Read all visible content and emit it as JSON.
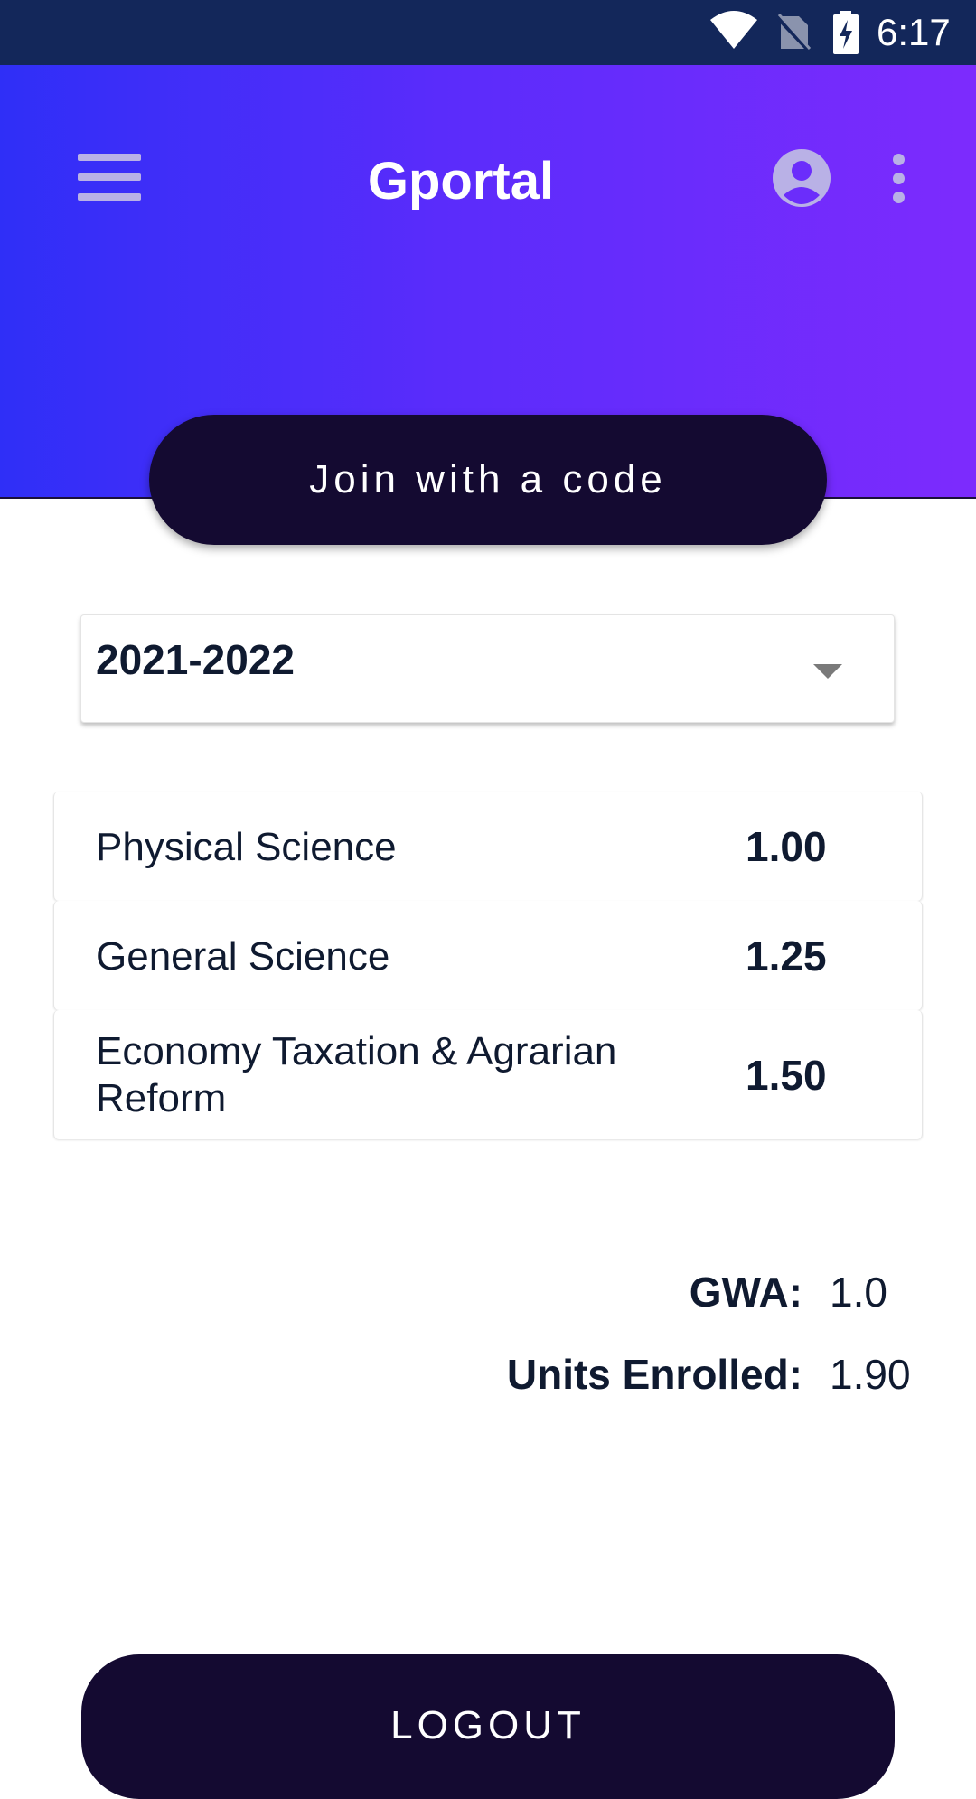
{
  "status_bar": {
    "time": "6:17",
    "icons": [
      "wifi-icon",
      "no-sim-icon",
      "battery-charging-icon"
    ]
  },
  "header": {
    "title": "Gportal",
    "join_label": "Join with a code",
    "icons": [
      "menu-icon",
      "account-circle-icon",
      "more-vert-icon"
    ],
    "gradient": [
      "#2f2ff7",
      "#7d2bfd"
    ]
  },
  "year_select": {
    "selected": "2021-2022"
  },
  "grades": [
    {
      "subject": "Physical Science",
      "grade": "1.00"
    },
    {
      "subject": "General Science",
      "grade": "1.25"
    },
    {
      "subject": "Economy Taxation & Agrarian Reform",
      "grade": "1.50"
    }
  ],
  "summary": {
    "gwa_label": "GWA:",
    "gwa_value": "1.0",
    "units_label": "Units Enrolled:",
    "units_value": "1.90"
  },
  "logout_label": "LOGOUT",
  "colors": {
    "status_bar": "#13275a",
    "button_dark": "#140a31",
    "text_dark": "#0f1a30"
  }
}
